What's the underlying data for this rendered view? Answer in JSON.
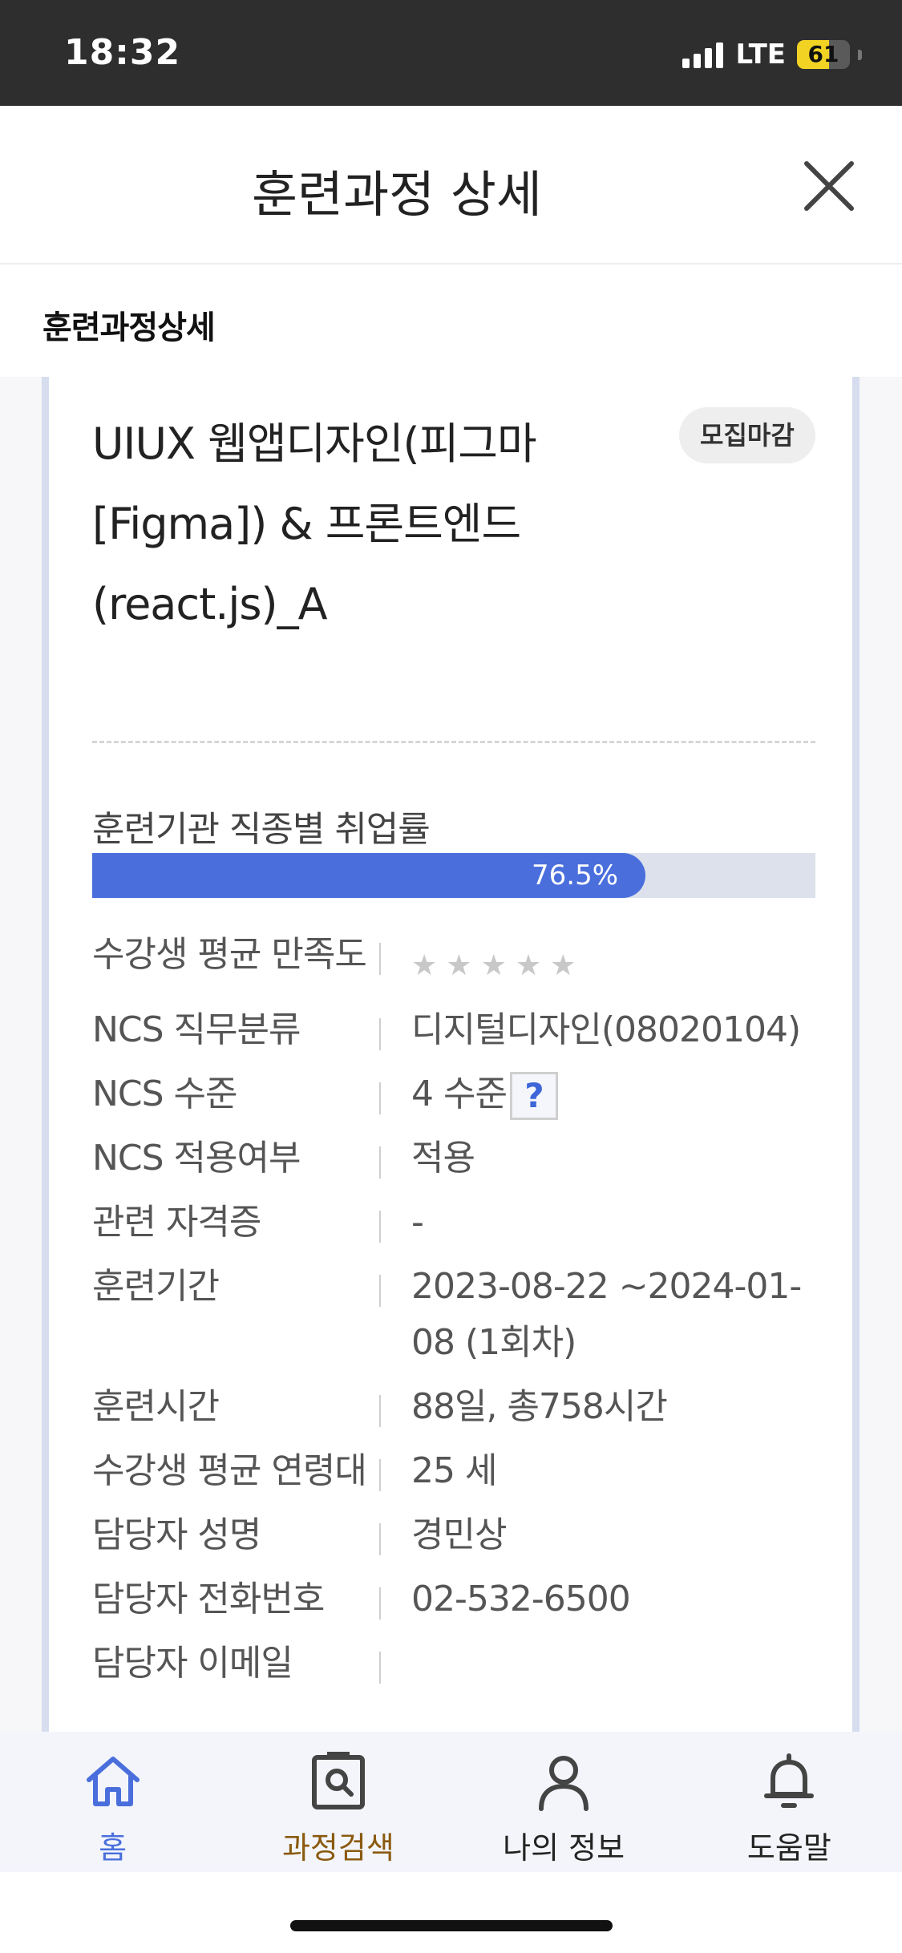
{
  "status_bar": {
    "time": "18:32",
    "network": "LTE",
    "battery": "61"
  },
  "header": {
    "title": "훈련과정 상세",
    "close_icon": "close-icon"
  },
  "section": {
    "label": "훈련과정상세"
  },
  "course": {
    "title": "UIUX 웹앱디자인(피그마[Figma]) & 프론트엔드(react.js)_A",
    "status": "모집마감",
    "employment_rate_label": "훈련기관 직종별 취업률",
    "employment_rate": 76.5,
    "employment_rate_text": "76.5%"
  },
  "info": [
    {
      "key": "수강생 평균 만족도",
      "type": "stars",
      "value": "",
      "stars_filled": 0,
      "stars_total": 5
    },
    {
      "key": "NCS 직무분류",
      "value": "디지털디자인(08020104)"
    },
    {
      "key": "NCS 수준",
      "value": "4 수준",
      "help": "?"
    },
    {
      "key": "NCS 적용여부",
      "value": "적용"
    },
    {
      "key": "관련 자격증",
      "value": "-"
    },
    {
      "key": "훈련기간",
      "value": "2023-08-22 ~2024-01-08 (1회차)"
    },
    {
      "key": "훈련시간",
      "value": "88일, 총758시간"
    },
    {
      "key": "수강생 평균 연령대",
      "value": "25 세"
    },
    {
      "key": "담당자 성명",
      "value": "경민상"
    },
    {
      "key": "담당자 전화번호",
      "value": "02-532-6500"
    },
    {
      "key": "담당자 이메일",
      "value": ""
    }
  ],
  "nav": [
    {
      "label": "홈",
      "icon": "home-icon"
    },
    {
      "label": "과정검색",
      "icon": "search-icon"
    },
    {
      "label": "나의 정보",
      "icon": "user-icon"
    },
    {
      "label": "도움말",
      "icon": "bell-icon"
    }
  ],
  "colors": {
    "accent": "#4a6fdc",
    "search_active": "#8a5a0f",
    "progress_track": "#dde1ec"
  }
}
